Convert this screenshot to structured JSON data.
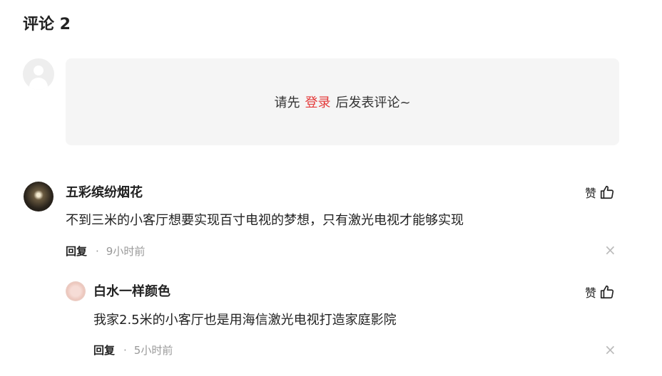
{
  "header": {
    "title": "评论 2"
  },
  "login_prompt": {
    "before": "请先",
    "link": "登录",
    "after": "后发表评论~"
  },
  "comments": [
    {
      "user": "五彩缤纷烟花",
      "text": "不到三米的小客厅想要实现百寸电视的梦想，只有激光电视才能够实现",
      "reply_label": "回复",
      "separator": "·",
      "time": "9小时前",
      "like_label": "赞",
      "close": "×"
    },
    {
      "user": "白水一样颜色",
      "text": "我家2.5米的小客厅也是用海信激光电视打造家庭影院",
      "reply_label": "回复",
      "separator": "·",
      "time": "5小时前",
      "like_label": "赞",
      "close": "×"
    }
  ],
  "colors": {
    "accent": "#e43a3a",
    "muted": "#999999",
    "box_bg": "#f5f5f5"
  },
  "icons": [
    "default-avatar-icon",
    "thumbs-up-icon",
    "close-icon"
  ]
}
